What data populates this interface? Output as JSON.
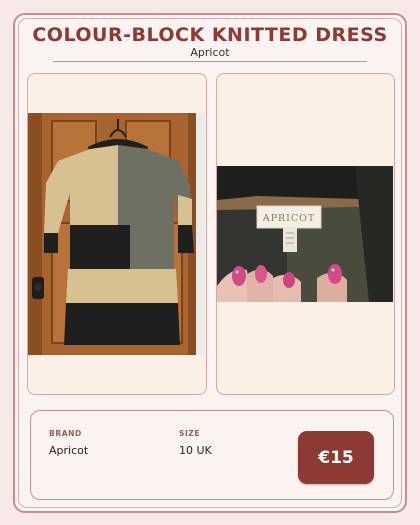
{
  "listing": {
    "title": "COLOUR-BLOCK KNITTED DRESS",
    "subtitle": "Apricot"
  },
  "photos": [
    {
      "alt": "Colour-block knitted dress hanging on a wooden door"
    },
    {
      "alt": "Close-up of the Apricot brand label inside the dress neckline"
    }
  ],
  "label_photo": {
    "brand_text": "APRICOT"
  },
  "details": {
    "brand_label": "BRAND",
    "brand_value": "Apricot",
    "size_label": "SIZE",
    "size_value": "10 UK"
  },
  "price": {
    "label": "€15"
  },
  "colors": {
    "accent": "#8c3a33",
    "border": "#c58f92",
    "panel": "#faf0e6",
    "background": "#f6e9e8"
  }
}
